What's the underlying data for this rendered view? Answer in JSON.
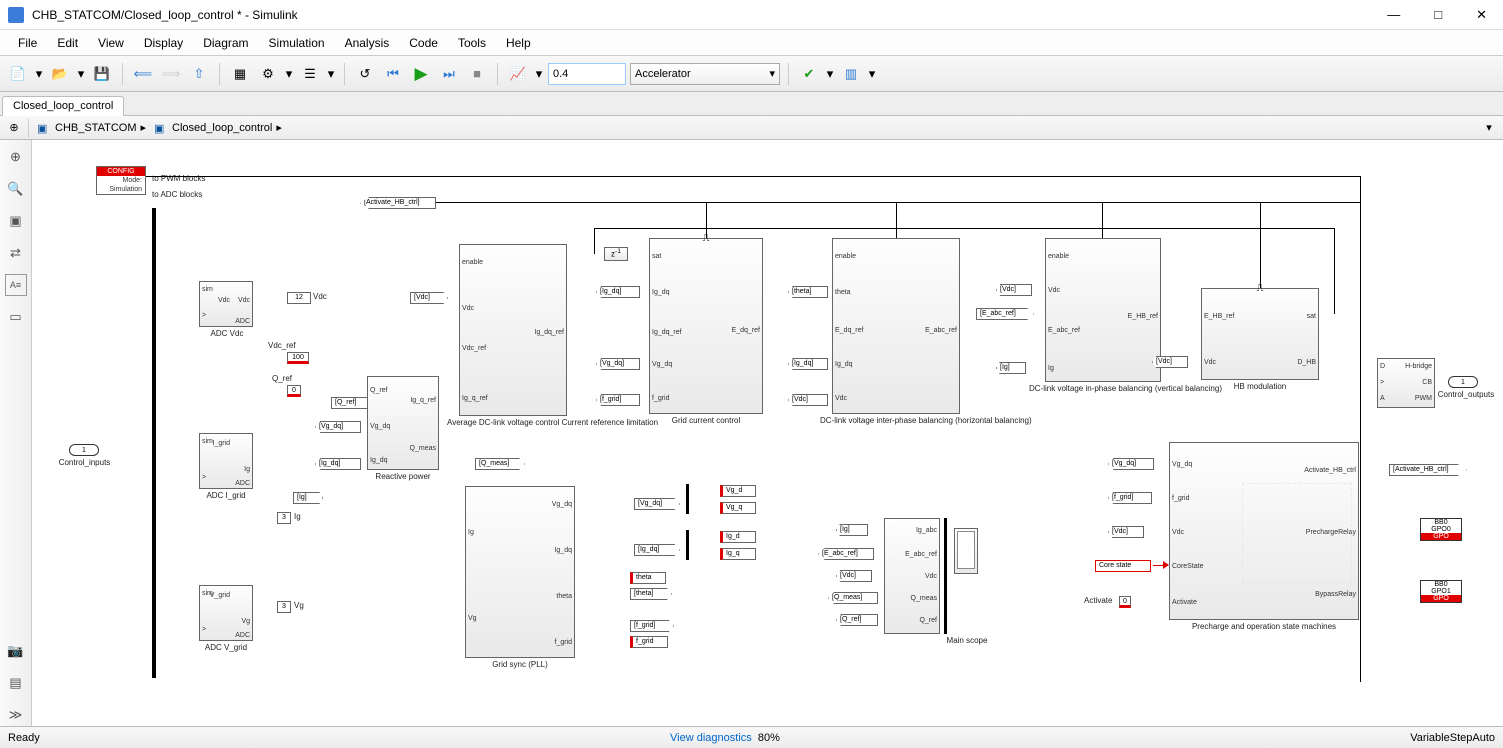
{
  "window": {
    "title": "CHB_STATCOM/Closed_loop_control * - Simulink"
  },
  "menu": {
    "items": [
      "File",
      "Edit",
      "View",
      "Display",
      "Diagram",
      "Simulation",
      "Analysis",
      "Code",
      "Tools",
      "Help"
    ]
  },
  "toolbar": {
    "stoptime": "0.4",
    "simmode": "Accelerator"
  },
  "tab": {
    "name": "Closed_loop_control"
  },
  "breadcrumb": {
    "root": "CHB_STATCOM",
    "sub": "Closed_loop_control"
  },
  "status": {
    "left": "Ready",
    "center": "View diagnostics",
    "zoom": "80%",
    "right": "VariableStepAuto"
  },
  "config": {
    "hdr": "CONFIG",
    "mode_label": "Mode:",
    "mode": "Simulation",
    "out1": "to PWM blocks",
    "out2": "to ADC blocks"
  },
  "ports": {
    "in": "Control_inputs",
    "out": "Control_outputs",
    "in_n": "1",
    "out_n": "1"
  },
  "blocks": {
    "adc_vdc": {
      "name": "ADC Vdc",
      "p1": "sim",
      "p2": "Vdc",
      "o1": "Vdc",
      "o2": "ADC"
    },
    "adc_igrid": {
      "name": "ADC I_grid",
      "p1": "sim",
      "p2": "I_grid",
      "o1": "Ig",
      "o2": "ADC"
    },
    "adc_vgrid": {
      "name": "ADC V_grid",
      "p1": "sim",
      "p2": "V_grid",
      "o1": "Vg",
      "o2": "ADC"
    },
    "rpow": {
      "name": "Reactive power",
      "p1": "Q_ref",
      "p2": "Vg_dq",
      "p3": "Ig_dq",
      "o1": "Ig_q_ref",
      "o2": "Q_meas"
    },
    "avg": {
      "name": "Average DC-link voltage control Current reference limitation",
      "en": "enable",
      "p1": "Vdc",
      "p2": "Vdc_ref",
      "p3": "Ig_q_ref",
      "o1": "Ig_dq_ref"
    },
    "gcc": {
      "name": "Grid current control",
      "p1": "sat",
      "p2": "Ig_dq",
      "p3": "Ig_dq_ref",
      "p4": "Vg_dq",
      "p5": "f_grid",
      "o1": "E_dq_ref"
    },
    "horiz": {
      "name": "DC-link voltage inter-phase balancing (horizontal balancing)",
      "en": "enable",
      "p1": "theta",
      "p2": "E_dq_ref",
      "p3": "Ig_dq",
      "p4": "Vdc",
      "o1": "E_abc_ref"
    },
    "vert": {
      "name": "DC-link voltage in-phase balancing (vertical balancing)",
      "en": "enable",
      "p1": "Vdc",
      "p2": "E_abc_ref",
      "p3": "Ig",
      "o1": "E_HB_ref"
    },
    "hbmod": {
      "name": "HB modulation",
      "p1": "E_HB_ref",
      "p2": "Vdc",
      "o1": "sat",
      "o2": "D_HB"
    },
    "pll": {
      "name": "Grid sync (PLL)",
      "p1": "Ig",
      "p2": "Vg",
      "o1": "Vg_dq",
      "o2": "Ig_dq",
      "o3": "theta",
      "o4": "f_grid"
    },
    "scope": {
      "name": "Main scope",
      "p1": "Ig_abc",
      "p2": "E_abc_ref",
      "p3": "Vdc",
      "p4": "Q_meas",
      "p5": "Q_ref"
    },
    "sm": {
      "name": "Precharge and operation state machines",
      "p1": "Vg_dq",
      "p2": "f_grid",
      "p3": "Vdc",
      "p4": "CoreState",
      "p5": "Activate",
      "o1": "Activate_HB_ctrl",
      "o2": "PrechargeRelay",
      "o3": "BypassRelay"
    },
    "hbout": {
      "name": "H-bridge",
      "p1": "D",
      "p2": ">",
      "p3": "A",
      "o2": "CB",
      "o3": "PWM"
    }
  },
  "tags": {
    "activate_hb": "[Activate_HB_ctrl]",
    "vdc": "[Vdc]",
    "vdc12": "12",
    "vdc_lbl": "Vdc",
    "vdc_ref": "Vdc_ref",
    "vdc_ref_v": "100",
    "q_ref": "Q_ref",
    "q_ref_v": "0",
    "q_ref_t": "[Q_ref]",
    "vg_dq": "[Vg_dq]",
    "ig_dq": "[Ig_dq]",
    "ig": "[Ig]",
    "ig3": "3",
    "ig_lbl": "Ig",
    "vg3": "3",
    "vg_lbl": "Vg",
    "q_meas": "[Q_meas]",
    "zinv": "z",
    "zinv_sup": "-1",
    "ig_dq2": "[Ig_dq]",
    "vg_dq2": "[Vg_dq]",
    "f_grid": "[f_grid]",
    "theta": "[theta]",
    "ig_dq3": "[Ig_dq]",
    "vdc2": "[Vdc]",
    "vdc3": "[Vdc]",
    "e_abc": "[E_abc_ref]",
    "ig2": "[Ig]",
    "vdc4": "[Vdc]",
    "vg_d": "Vg_d",
    "vg_q": "Vg_q",
    "ig_d": "Ig_d",
    "ig_q": "Ig_q",
    "theta_l": "theta",
    "f_grid_l": "f_grid",
    "vg_dq_t": "[Vg_dq]",
    "ig_dq_t": "[Ig_dq]",
    "theta_t": "[theta]",
    "f_grid_t": "[f_grid]",
    "ig_s": "[Ig]",
    "e_abc_s": "[E_abc_ref]",
    "vdc_s": "[Vdc]",
    "q_meas_s": "[Q_meas]",
    "q_ref_s": "[Q_ref]",
    "vg_dq_sm": "[Vg_dq]",
    "f_grid_sm": "[f_grid]",
    "vdc_sm": "[Vdc]",
    "core": "Core state",
    "activate": "Activate",
    "activate_v": "0",
    "act_hb_out": "[Activate_HB_ctrl]",
    "bb0_a": "BB0",
    "gpo0": "GPO0",
    "gpo": "GPO",
    "bb0_b": "BB0",
    "gpo1": "GPO1"
  }
}
